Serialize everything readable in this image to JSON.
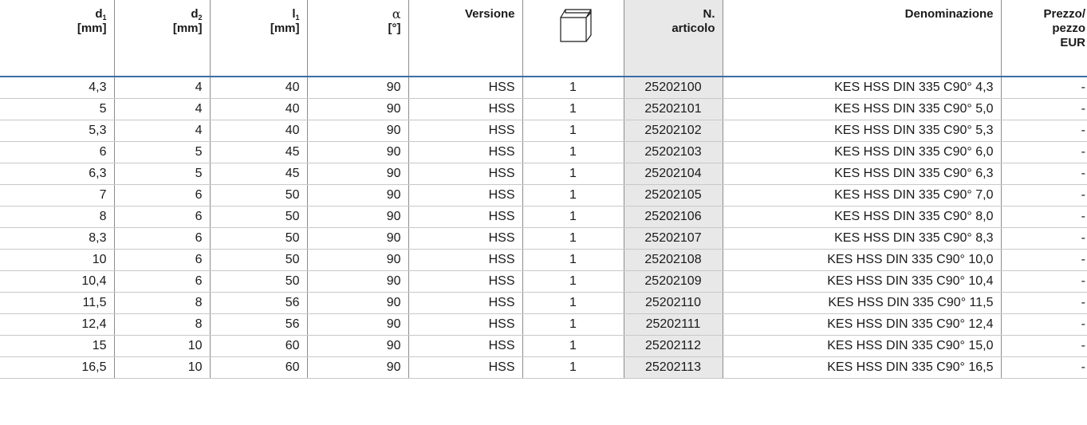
{
  "headers": {
    "d1": {
      "sym": "d",
      "sub": "1",
      "unit": "[mm]"
    },
    "d2": {
      "sym": "d",
      "sub": "2",
      "unit": "[mm]"
    },
    "l1": {
      "sym": "l",
      "sub": "1",
      "unit": "[mm]"
    },
    "alpha": {
      "sym": "α",
      "unit": "[°]"
    },
    "versione": "Versione",
    "pack_icon": "box-icon",
    "articolo": {
      "line1": "N.",
      "line2": "articolo"
    },
    "denominazione": "Denominazione",
    "prezzo": {
      "line1": "Prezzo/",
      "line2": "pezzo",
      "line3": "EUR"
    }
  },
  "rows": [
    {
      "d1": "4,3",
      "d2": "4",
      "l1": "40",
      "alpha": "90",
      "versione": "HSS",
      "pack": "1",
      "articolo": "25202100",
      "denominazione": "KES HSS DIN 335 C90° 4,3",
      "prezzo": "-"
    },
    {
      "d1": "5",
      "d2": "4",
      "l1": "40",
      "alpha": "90",
      "versione": "HSS",
      "pack": "1",
      "articolo": "25202101",
      "denominazione": "KES HSS DIN 335 C90° 5,0",
      "prezzo": "-"
    },
    {
      "d1": "5,3",
      "d2": "4",
      "l1": "40",
      "alpha": "90",
      "versione": "HSS",
      "pack": "1",
      "articolo": "25202102",
      "denominazione": "KES HSS DIN 335 C90° 5,3",
      "prezzo": "-"
    },
    {
      "d1": "6",
      "d2": "5",
      "l1": "45",
      "alpha": "90",
      "versione": "HSS",
      "pack": "1",
      "articolo": "25202103",
      "denominazione": "KES HSS DIN 335 C90° 6,0",
      "prezzo": "-"
    },
    {
      "d1": "6,3",
      "d2": "5",
      "l1": "45",
      "alpha": "90",
      "versione": "HSS",
      "pack": "1",
      "articolo": "25202104",
      "denominazione": "KES HSS DIN 335 C90° 6,3",
      "prezzo": "-"
    },
    {
      "d1": "7",
      "d2": "6",
      "l1": "50",
      "alpha": "90",
      "versione": "HSS",
      "pack": "1",
      "articolo": "25202105",
      "denominazione": "KES HSS DIN 335 C90° 7,0",
      "prezzo": "-"
    },
    {
      "d1": "8",
      "d2": "6",
      "l1": "50",
      "alpha": "90",
      "versione": "HSS",
      "pack": "1",
      "articolo": "25202106",
      "denominazione": "KES HSS DIN 335 C90° 8,0",
      "prezzo": "-"
    },
    {
      "d1": "8,3",
      "d2": "6",
      "l1": "50",
      "alpha": "90",
      "versione": "HSS",
      "pack": "1",
      "articolo": "25202107",
      "denominazione": "KES HSS DIN 335 C90° 8,3",
      "prezzo": "-"
    },
    {
      "d1": "10",
      "d2": "6",
      "l1": "50",
      "alpha": "90",
      "versione": "HSS",
      "pack": "1",
      "articolo": "25202108",
      "denominazione": "KES HSS DIN 335 C90° 10,0",
      "prezzo": "-"
    },
    {
      "d1": "10,4",
      "d2": "6",
      "l1": "50",
      "alpha": "90",
      "versione": "HSS",
      "pack": "1",
      "articolo": "25202109",
      "denominazione": "KES HSS DIN 335 C90° 10,4",
      "prezzo": "-"
    },
    {
      "d1": "11,5",
      "d2": "8",
      "l1": "56",
      "alpha": "90",
      "versione": "HSS",
      "pack": "1",
      "articolo": "25202110",
      "denominazione": "KES HSS DIN 335 C90° 11,5",
      "prezzo": "-"
    },
    {
      "d1": "12,4",
      "d2": "8",
      "l1": "56",
      "alpha": "90",
      "versione": "HSS",
      "pack": "1",
      "articolo": "25202111",
      "denominazione": "KES HSS DIN 335 C90° 12,4",
      "prezzo": "-"
    },
    {
      "d1": "15",
      "d2": "10",
      "l1": "60",
      "alpha": "90",
      "versione": "HSS",
      "pack": "1",
      "articolo": "25202112",
      "denominazione": "KES HSS DIN 335 C90° 15,0",
      "prezzo": "-"
    },
    {
      "d1": "16,5",
      "d2": "10",
      "l1": "60",
      "alpha": "90",
      "versione": "HSS",
      "pack": "1",
      "articolo": "25202113",
      "denominazione": "KES HSS DIN 335 C90° 16,5",
      "prezzo": "-"
    }
  ],
  "colors": {
    "header_rule": "#3a6ea5",
    "article_column_bg": "#e8e8e8",
    "grid": "#8c8c8c"
  }
}
